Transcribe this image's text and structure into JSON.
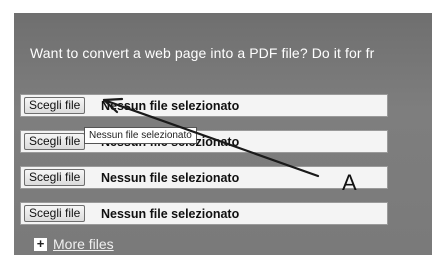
{
  "headline": "Want to convert a web page into a PDF file? Do it for fr",
  "file_inputs": [
    {
      "button_label": "Scegli file",
      "status": "Nessun file selezionato"
    },
    {
      "button_label": "Scegli file",
      "status": "Nessun file selezionato"
    },
    {
      "button_label": "Scegli file",
      "status": "Nessun file selezionato"
    },
    {
      "button_label": "Scegli file",
      "status": "Nessun file selezionato"
    }
  ],
  "tooltip": "Nessun file selezionato",
  "more_files": {
    "icon": "plus-icon",
    "label": "More files"
  },
  "annotation": {
    "label": "A"
  }
}
